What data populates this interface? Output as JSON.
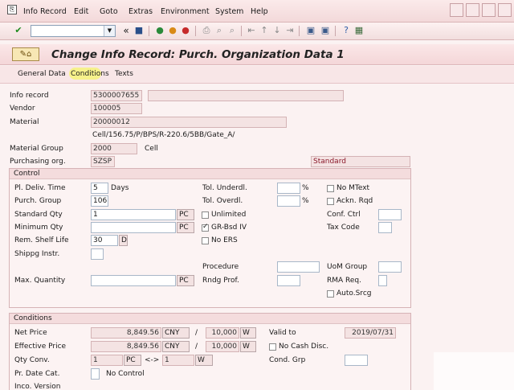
{
  "menu": {
    "items": [
      "Info Record",
      "Edit",
      "Goto",
      "Extras",
      "Environment",
      "System",
      "Help"
    ]
  },
  "toolbar": {
    "command_value": ""
  },
  "header": {
    "title": "Change Info Record: Purch. Organization Data 1"
  },
  "tabs": [
    "General Data",
    "Conditions",
    "Texts"
  ],
  "info": {
    "info_record_label": "Info record",
    "info_record_value": "5300007655",
    "info_record_desc": "",
    "vendor_label": "Vendor",
    "vendor_value": "100005",
    "material_label": "Material",
    "material_value": "20000012",
    "material_desc": "Cell/156.75/P/BPS/R-220.6/5BB/Gate_A/",
    "material_group_label": "Material Group",
    "material_group_value": "2000",
    "material_group_desc": "Cell",
    "purch_org_label": "Purchasing org.",
    "purch_org_value": "SZSP",
    "purch_org_type": "Standard"
  },
  "control": {
    "title": "Control",
    "pl_deliv_time_label": "Pl. Deliv. Time",
    "pl_deliv_time_value": "5",
    "days_label": "Days",
    "purch_group_label": "Purch. Group",
    "purch_group_value": "106",
    "standard_qty_label": "Standard Qty",
    "standard_qty_value": "1",
    "standard_qty_unit": "PC",
    "minimum_qty_label": "Minimum Qty",
    "minimum_qty_value": "",
    "minimum_qty_unit": "PC",
    "rem_shelf_life_label": "Rem. Shelf Life",
    "rem_shelf_life_value": "30",
    "rem_shelf_life_unit": "D",
    "shippg_instr_label": "Shippg Instr.",
    "max_qty_label": "Max. Quantity",
    "max_qty_unit": "PC",
    "tol_underdl_label": "Tol. Underdl.",
    "tol_overdl_label": "Tol. Overdl.",
    "percent": "%",
    "unlimited_label": "Unlimited",
    "gr_bsd_iv_label": "GR-Bsd IV",
    "no_ers_label": "No ERS",
    "procedure_label": "Procedure",
    "rndg_prof_label": "Rndg Prof.",
    "no_mtext_label": "No MText",
    "ackn_rqd_label": "Ackn. Rqd",
    "conf_ctrl_label": "Conf. Ctrl",
    "tax_code_label": "Tax Code",
    "uom_group_label": "UoM Group",
    "rma_req_label": "RMA Req.",
    "auto_srcg_label": "Auto.Srcg",
    "gr_bsd_iv_checked": true
  },
  "conditions": {
    "title": "Conditions",
    "net_price_label": "Net Price",
    "net_price_value": "8,849.56",
    "net_price_currency": "CNY",
    "net_price_per": "10,000",
    "net_price_uom": "W",
    "effective_price_label": "Effective Price",
    "effective_price_value": "8,849.56",
    "effective_price_currency": "CNY",
    "effective_price_per": "10,000",
    "effective_price_uom": "W",
    "slash": "/",
    "valid_to_label": "Valid to",
    "valid_to_value": "2019/07/31",
    "no_cash_disc_label": "No Cash Disc.",
    "qty_conv_label": "Qty Conv.",
    "qty_conv_from": "1",
    "qty_conv_from_unit": "PC",
    "qty_conv_arrow": "<->",
    "qty_conv_to": "1",
    "qty_conv_to_unit": "W",
    "cond_grp_label": "Cond. Grp",
    "pr_date_cat_label": "Pr. Date Cat.",
    "no_control_label": "No Control",
    "inco_version_label": "Inco. Version"
  },
  "colors": {
    "accent": "#8b1a2b",
    "panel": "#fcf3f3"
  }
}
